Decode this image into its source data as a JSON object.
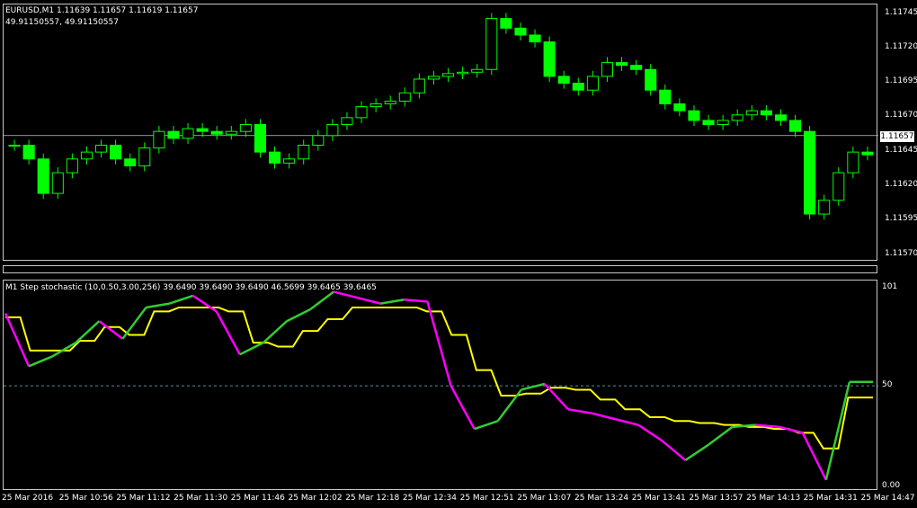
{
  "main": {
    "symbol_line": "EURUSD,M1  1.11639 1.11657 1.11619 1.11657",
    "sub_line": "49.91150557, 49.91150557",
    "current_price": "1.11657",
    "prices": [
      "1.11745",
      "1.11720",
      "1.11695",
      "1.11670",
      "1.11645",
      "1.11620",
      "1.11595",
      "1.11570"
    ]
  },
  "indicator": {
    "title": "M1 Step stochastic (10,0.50,3.00,256) 39.6490 39.6490 39.6490 46.5699 39.6465 39.6465",
    "levels": [
      "101",
      "50",
      "0.00"
    ]
  },
  "time_axis": [
    "25 Mar 2016",
    "25 Mar 10:56",
    "25 Mar 11:12",
    "25 Mar 11:30",
    "25 Mar 11:46",
    "25 Mar 12:02",
    "25 Mar 12:18",
    "25 Mar 12:34",
    "25 Mar 12:51",
    "25 Mar 13:07",
    "25 Mar 13:24",
    "25 Mar 13:41",
    "25 Mar 13:57",
    "25 Mar 14:13",
    "25 Mar 14:31",
    "25 Mar 14:47"
  ],
  "colors": {
    "candles": "#00ff00",
    "stoch_up": "#32cd32",
    "stoch_down": "#ff00ff",
    "signal": "#ffff00",
    "level": "#4a8fa0",
    "grid": "#c8c8c8"
  },
  "chart_data": {
    "type": "line",
    "close_series": [
      1.1165,
      1.1164,
      1.11615,
      1.1163,
      1.1164,
      1.11645,
      1.1165,
      1.1164,
      1.11635,
      1.11648,
      1.1166,
      1.11655,
      1.11662,
      1.1166,
      1.11658,
      1.1166,
      1.11665,
      1.11645,
      1.11637,
      1.1164,
      1.1165,
      1.11657,
      1.11665,
      1.1167,
      1.11678,
      1.1168,
      1.11682,
      1.11688,
      1.11698,
      1.117,
      1.11702,
      1.11703,
      1.11705,
      1.11742,
      1.11735,
      1.1173,
      1.11725,
      1.117,
      1.11695,
      1.1169,
      1.117,
      1.1171,
      1.11708,
      1.11705,
      1.1169,
      1.1168,
      1.11675,
      1.11668,
      1.11665,
      1.11668,
      1.11672,
      1.11675,
      1.11672,
      1.11668,
      1.1166,
      1.116,
      1.1161,
      1.1163,
      1.11645,
      1.11643
    ],
    "stoch_main": [
      87,
      60,
      65,
      72,
      83,
      74,
      90,
      92,
      96,
      88,
      66,
      72,
      83,
      89,
      98,
      95,
      92,
      94,
      93,
      50,
      28,
      32,
      48,
      51,
      38,
      36,
      33,
      30,
      22,
      12,
      20,
      29,
      30,
      29,
      26,
      2,
      52,
      52
    ],
    "stoch_signal": [
      85,
      68,
      68,
      73,
      80,
      76,
      88,
      90,
      90,
      88,
      72,
      70,
      78,
      84,
      90,
      90,
      90,
      88,
      76,
      58,
      45,
      46,
      49,
      48,
      43,
      38,
      34,
      32,
      31,
      30,
      29,
      28,
      26,
      18,
      44,
      44
    ]
  }
}
